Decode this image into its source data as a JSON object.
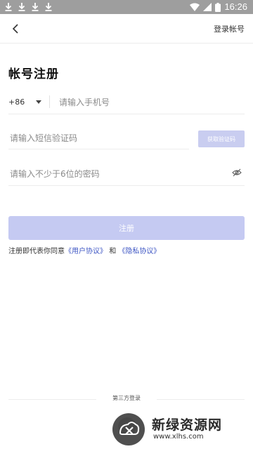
{
  "status_bar": {
    "time": "16:26",
    "left_icons": [
      "download-icon",
      "download-icon",
      "download-icon",
      "download-icon"
    ],
    "right_icons": [
      "wifi-icon",
      "signal-icon",
      "battery-icon"
    ]
  },
  "header": {
    "back_icon": "chevron-left-icon",
    "login_link": "登录帐号"
  },
  "title": "帐号注册",
  "form": {
    "country_code": "+86",
    "phone_placeholder": "请输入手机号",
    "code_placeholder": "请输入短信验证码",
    "get_code_label": "获取验证码",
    "password_placeholder": "请输入不少于6位的密码",
    "password_toggle_icon": "eye-off-icon",
    "register_label": "注册"
  },
  "agreement": {
    "prefix": "注册即代表你同意",
    "user_agreement": "《用户协议》",
    "and": "和",
    "privacy_agreement": "《隐私协议》"
  },
  "third_party": {
    "label": "第三方登录"
  },
  "watermark": {
    "text": "新绿资源网",
    "url": "www.xlhs.com"
  },
  "colors": {
    "status_bar": "#9e9e9e",
    "primary_disabled": "#c5caf2",
    "link": "#3f57c4"
  }
}
